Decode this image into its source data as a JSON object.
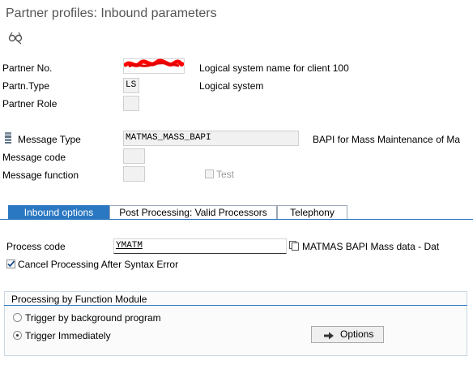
{
  "window": {
    "title": "Partner profiles: Inbound parameters"
  },
  "icons": {
    "toolbar_display": "glasses-icon",
    "message_type": "document-stack-icon",
    "options": "arrow-right-icon",
    "process_code_help": "copy-icon"
  },
  "partner": {
    "partner_no_label": "Partner No.",
    "partner_no_desc": "Logical system name for client 100",
    "partn_type_label": "Partn.Type",
    "partn_type_value": "LS",
    "partn_type_desc": "Logical system",
    "partner_role_label": "Partner Role"
  },
  "message": {
    "type_label": "Message Type",
    "type_value": "MATMAS_MASS_BAPI",
    "type_desc": "BAPI for Mass Maintenance of Ma",
    "code_label": "Message code",
    "function_label": "Message function",
    "test_label": "Test"
  },
  "tabs": [
    {
      "label": "Inbound options"
    },
    {
      "label": "Post Processing: Valid Processors"
    },
    {
      "label": "Telephony"
    }
  ],
  "inbound": {
    "process_code_label": "Process code",
    "process_code_value": "YMATM",
    "process_code_desc": "MATMAS BAPI Mass data - Dat",
    "cancel_label": "Cancel Processing After Syntax Error",
    "cancel_checked": true
  },
  "processing": {
    "group_title": "Processing by Function Module",
    "trigger_bg_label": "Trigger by background program",
    "trigger_imm_label": "Trigger Immediately",
    "selected": "trigger_immediately",
    "options_label": "Options"
  },
  "colors": {
    "accent": "#2b78c2",
    "redaction": "#ff0000"
  }
}
